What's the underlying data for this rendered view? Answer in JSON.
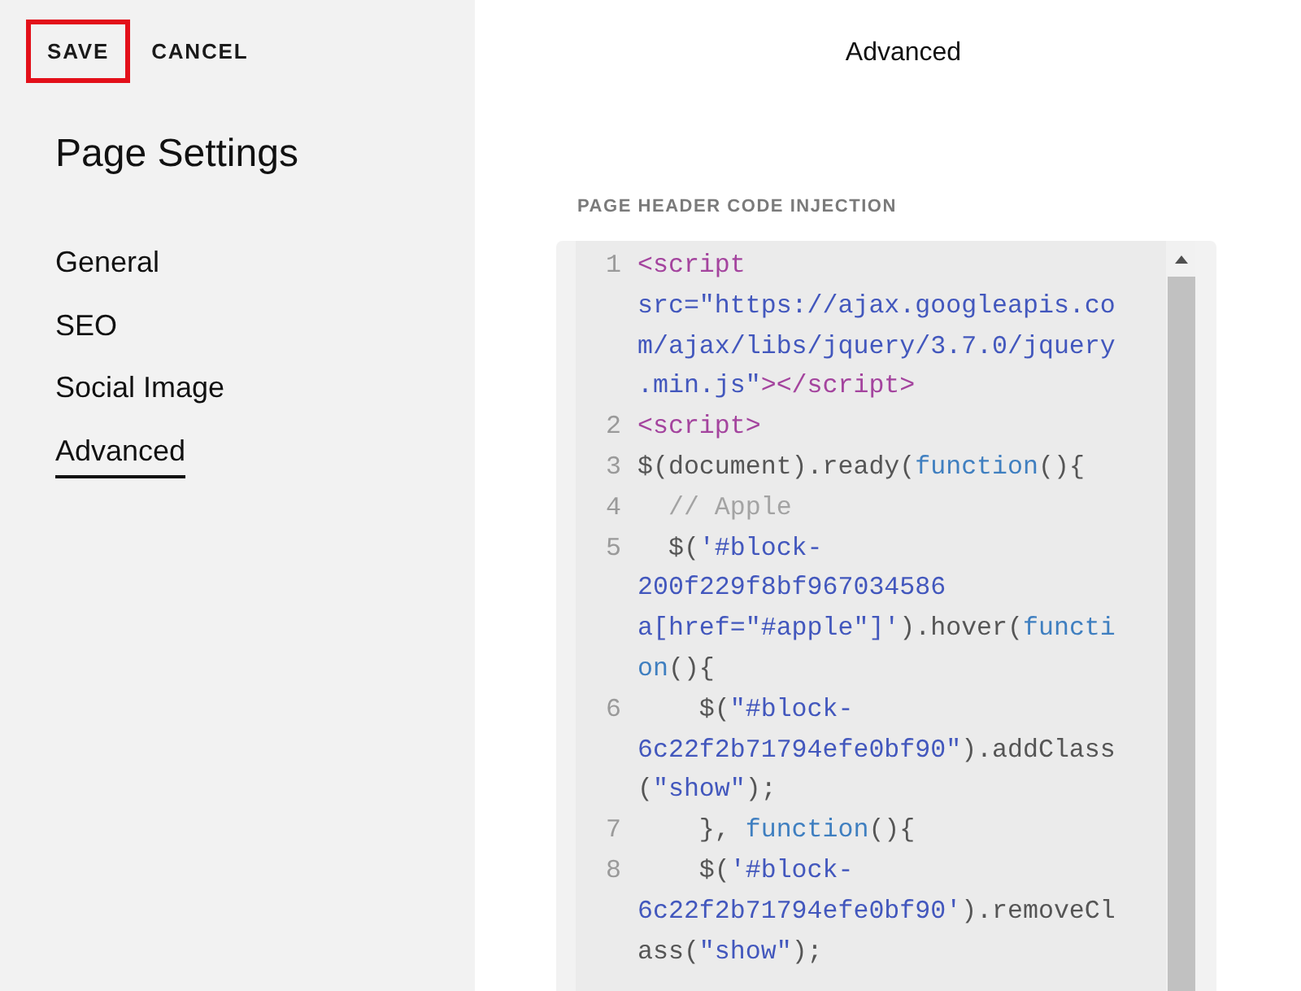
{
  "actions": [
    {
      "label": "SAVE",
      "highlighted": true
    },
    {
      "label": "CANCEL",
      "highlighted": false
    }
  ],
  "sidebar": {
    "title": "Page Settings",
    "items": [
      {
        "label": "General",
        "selected": false
      },
      {
        "label": "SEO",
        "selected": false
      },
      {
        "label": "Social Image",
        "selected": false
      },
      {
        "label": "Advanced",
        "selected": true
      }
    ]
  },
  "panel": {
    "title": "Advanced",
    "field_label": "PAGE HEADER CODE INJECTION",
    "code_lines": [
      {
        "number": "1",
        "rows": [
          [
            {
              "kind": "tag",
              "text": "<script"
            }
          ],
          [
            {
              "kind": "string",
              "text": "src=\"https://ajax.googleapis.co"
            }
          ],
          [
            {
              "kind": "string",
              "text": "m/ajax/libs/jquery/3.7.0/jquery"
            }
          ],
          [
            {
              "kind": "string",
              "text": ".min.js\""
            },
            {
              "kind": "tag",
              "text": "></script>"
            }
          ]
        ]
      },
      {
        "number": "2",
        "rows": [
          [
            {
              "kind": "tag",
              "text": "<script>"
            }
          ]
        ]
      },
      {
        "number": "3",
        "rows": [
          [
            {
              "kind": "plain",
              "text": "$(document).ready("
            },
            {
              "kind": "keyword",
              "text": "function"
            },
            {
              "kind": "plain",
              "text": "(){"
            }
          ]
        ]
      },
      {
        "number": "4",
        "rows": [
          [
            {
              "kind": "comment",
              "text": "  // Apple"
            }
          ]
        ]
      },
      {
        "number": "5",
        "rows": [
          [
            {
              "kind": "plain",
              "text": "  $("
            },
            {
              "kind": "string",
              "text": "'#block-"
            }
          ],
          [
            {
              "kind": "string",
              "text": "200f229f8bf967034586"
            }
          ],
          [
            {
              "kind": "string",
              "text": "a[href=\"#apple\"]'"
            },
            {
              "kind": "plain",
              "text": ").hover("
            },
            {
              "kind": "keyword",
              "text": "functi"
            }
          ],
          [
            {
              "kind": "keyword",
              "text": "on"
            },
            {
              "kind": "plain",
              "text": "(){"
            }
          ]
        ]
      },
      {
        "number": "6",
        "rows": [
          [
            {
              "kind": "plain",
              "text": "    $("
            },
            {
              "kind": "string",
              "text": "\"#block-"
            }
          ],
          [
            {
              "kind": "string",
              "text": "6c22f2b71794efe0bf90\""
            },
            {
              "kind": "plain",
              "text": ").addClass"
            }
          ],
          [
            {
              "kind": "plain",
              "text": "("
            },
            {
              "kind": "string",
              "text": "\"show\""
            },
            {
              "kind": "plain",
              "text": ");"
            }
          ]
        ]
      },
      {
        "number": "7",
        "rows": [
          [
            {
              "kind": "plain",
              "text": "    }, "
            },
            {
              "kind": "keyword",
              "text": "function"
            },
            {
              "kind": "plain",
              "text": "(){"
            }
          ]
        ]
      },
      {
        "number": "8",
        "rows": [
          [
            {
              "kind": "plain",
              "text": "    $("
            },
            {
              "kind": "string",
              "text": "'#block-"
            }
          ],
          [
            {
              "kind": "string",
              "text": "6c22f2b71794efe0bf90'"
            },
            {
              "kind": "plain",
              "text": ").removeCl"
            }
          ],
          [
            {
              "kind": "plain",
              "text": "ass("
            },
            {
              "kind": "string",
              "text": "\"show\""
            },
            {
              "kind": "plain",
              "text": ");"
            }
          ]
        ]
      }
    ]
  }
}
